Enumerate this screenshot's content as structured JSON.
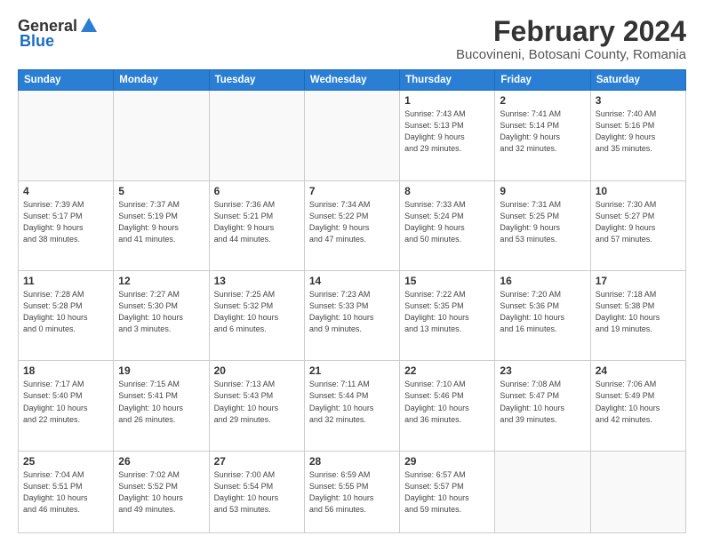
{
  "header": {
    "logo_general": "General",
    "logo_blue": "Blue",
    "month_title": "February 2024",
    "location": "Bucovineni, Botosani County, Romania"
  },
  "days_of_week": [
    "Sunday",
    "Monday",
    "Tuesday",
    "Wednesday",
    "Thursday",
    "Friday",
    "Saturday"
  ],
  "weeks": [
    [
      {
        "day": "",
        "info": ""
      },
      {
        "day": "",
        "info": ""
      },
      {
        "day": "",
        "info": ""
      },
      {
        "day": "",
        "info": ""
      },
      {
        "day": "1",
        "info": "Sunrise: 7:43 AM\nSunset: 5:13 PM\nDaylight: 9 hours\nand 29 minutes."
      },
      {
        "day": "2",
        "info": "Sunrise: 7:41 AM\nSunset: 5:14 PM\nDaylight: 9 hours\nand 32 minutes."
      },
      {
        "day": "3",
        "info": "Sunrise: 7:40 AM\nSunset: 5:16 PM\nDaylight: 9 hours\nand 35 minutes."
      }
    ],
    [
      {
        "day": "4",
        "info": "Sunrise: 7:39 AM\nSunset: 5:17 PM\nDaylight: 9 hours\nand 38 minutes."
      },
      {
        "day": "5",
        "info": "Sunrise: 7:37 AM\nSunset: 5:19 PM\nDaylight: 9 hours\nand 41 minutes."
      },
      {
        "day": "6",
        "info": "Sunrise: 7:36 AM\nSunset: 5:21 PM\nDaylight: 9 hours\nand 44 minutes."
      },
      {
        "day": "7",
        "info": "Sunrise: 7:34 AM\nSunset: 5:22 PM\nDaylight: 9 hours\nand 47 minutes."
      },
      {
        "day": "8",
        "info": "Sunrise: 7:33 AM\nSunset: 5:24 PM\nDaylight: 9 hours\nand 50 minutes."
      },
      {
        "day": "9",
        "info": "Sunrise: 7:31 AM\nSunset: 5:25 PM\nDaylight: 9 hours\nand 53 minutes."
      },
      {
        "day": "10",
        "info": "Sunrise: 7:30 AM\nSunset: 5:27 PM\nDaylight: 9 hours\nand 57 minutes."
      }
    ],
    [
      {
        "day": "11",
        "info": "Sunrise: 7:28 AM\nSunset: 5:28 PM\nDaylight: 10 hours\nand 0 minutes."
      },
      {
        "day": "12",
        "info": "Sunrise: 7:27 AM\nSunset: 5:30 PM\nDaylight: 10 hours\nand 3 minutes."
      },
      {
        "day": "13",
        "info": "Sunrise: 7:25 AM\nSunset: 5:32 PM\nDaylight: 10 hours\nand 6 minutes."
      },
      {
        "day": "14",
        "info": "Sunrise: 7:23 AM\nSunset: 5:33 PM\nDaylight: 10 hours\nand 9 minutes."
      },
      {
        "day": "15",
        "info": "Sunrise: 7:22 AM\nSunset: 5:35 PM\nDaylight: 10 hours\nand 13 minutes."
      },
      {
        "day": "16",
        "info": "Sunrise: 7:20 AM\nSunset: 5:36 PM\nDaylight: 10 hours\nand 16 minutes."
      },
      {
        "day": "17",
        "info": "Sunrise: 7:18 AM\nSunset: 5:38 PM\nDaylight: 10 hours\nand 19 minutes."
      }
    ],
    [
      {
        "day": "18",
        "info": "Sunrise: 7:17 AM\nSunset: 5:40 PM\nDaylight: 10 hours\nand 22 minutes."
      },
      {
        "day": "19",
        "info": "Sunrise: 7:15 AM\nSunset: 5:41 PM\nDaylight: 10 hours\nand 26 minutes."
      },
      {
        "day": "20",
        "info": "Sunrise: 7:13 AM\nSunset: 5:43 PM\nDaylight: 10 hours\nand 29 minutes."
      },
      {
        "day": "21",
        "info": "Sunrise: 7:11 AM\nSunset: 5:44 PM\nDaylight: 10 hours\nand 32 minutes."
      },
      {
        "day": "22",
        "info": "Sunrise: 7:10 AM\nSunset: 5:46 PM\nDaylight: 10 hours\nand 36 minutes."
      },
      {
        "day": "23",
        "info": "Sunrise: 7:08 AM\nSunset: 5:47 PM\nDaylight: 10 hours\nand 39 minutes."
      },
      {
        "day": "24",
        "info": "Sunrise: 7:06 AM\nSunset: 5:49 PM\nDaylight: 10 hours\nand 42 minutes."
      }
    ],
    [
      {
        "day": "25",
        "info": "Sunrise: 7:04 AM\nSunset: 5:51 PM\nDaylight: 10 hours\nand 46 minutes."
      },
      {
        "day": "26",
        "info": "Sunrise: 7:02 AM\nSunset: 5:52 PM\nDaylight: 10 hours\nand 49 minutes."
      },
      {
        "day": "27",
        "info": "Sunrise: 7:00 AM\nSunset: 5:54 PM\nDaylight: 10 hours\nand 53 minutes."
      },
      {
        "day": "28",
        "info": "Sunrise: 6:59 AM\nSunset: 5:55 PM\nDaylight: 10 hours\nand 56 minutes."
      },
      {
        "day": "29",
        "info": "Sunrise: 6:57 AM\nSunset: 5:57 PM\nDaylight: 10 hours\nand 59 minutes."
      },
      {
        "day": "",
        "info": ""
      },
      {
        "day": "",
        "info": ""
      }
    ]
  ]
}
